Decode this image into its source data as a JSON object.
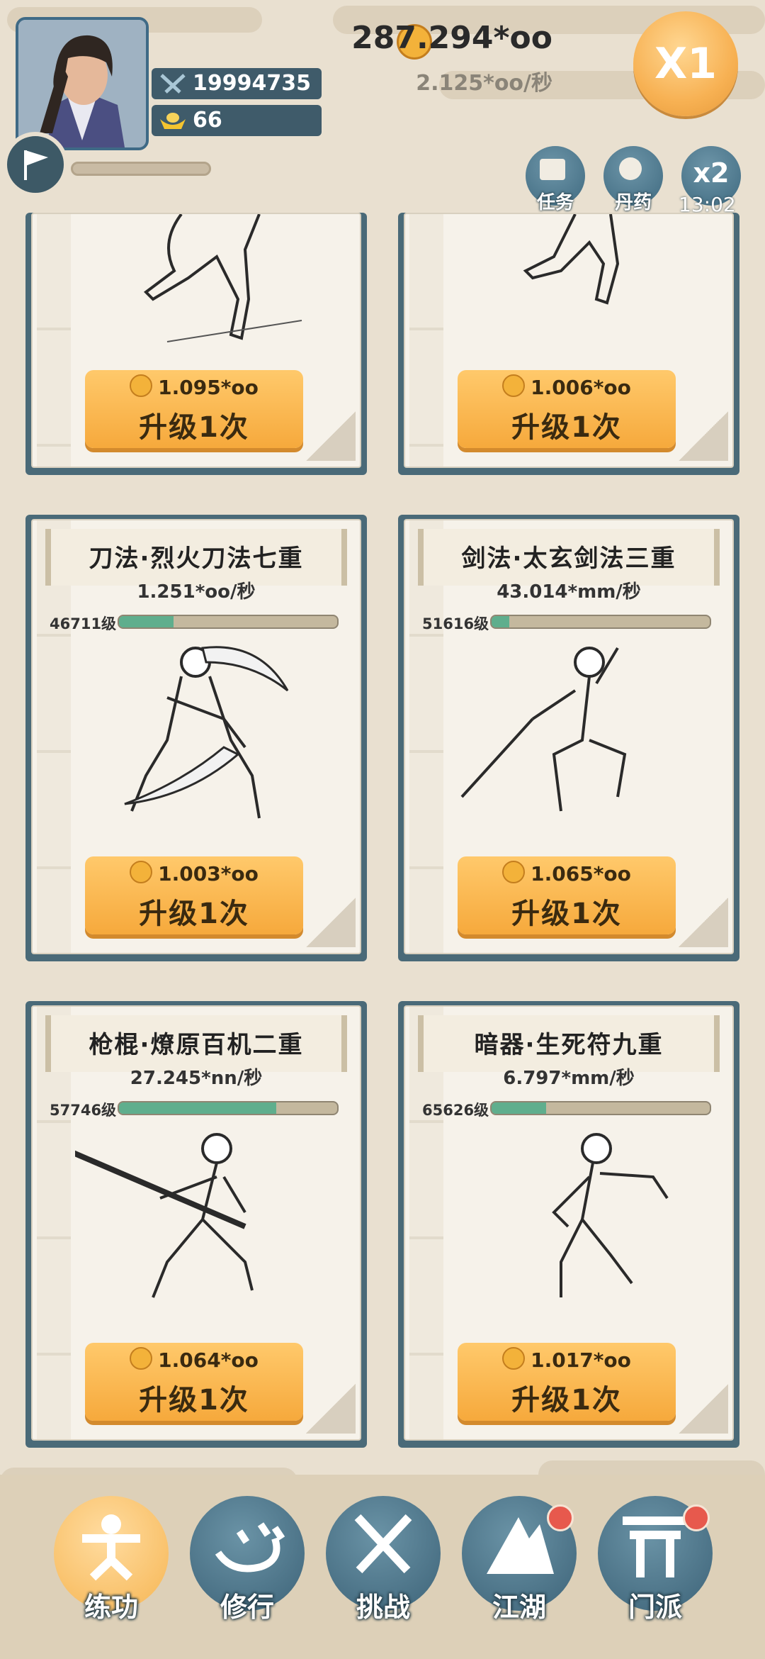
{
  "header": {
    "power": "19994735",
    "gold_ingot": "66",
    "coin_total": "287.294*oo",
    "coin_rate": "2.125*oo/秒",
    "speed_multiplier": "X1",
    "quick_buttons": [
      {
        "label": "任务",
        "icon": "scroll-icon"
      },
      {
        "label": "丹药",
        "icon": "elixir-icon"
      },
      {
        "label": "x2",
        "icon": "double-speed-icon"
      }
    ],
    "x2_timer": "13:02"
  },
  "partial_cards": [
    {
      "cost": "1.095*oo",
      "action": "升级1次"
    },
    {
      "cost": "1.006*oo",
      "action": "升级1次"
    }
  ],
  "cards": [
    {
      "title": "刀法·烈火刀法七重",
      "rate": "1.251*oo/秒",
      "level": "46711级",
      "progress": 0.25,
      "cost": "1.003*oo",
      "action": "升级1次",
      "figure": "saber-fighter"
    },
    {
      "title": "剑法·太玄剑法三重",
      "rate": "43.014*mm/秒",
      "level": "51616级",
      "progress": 0.08,
      "cost": "1.065*oo",
      "action": "升级1次",
      "figure": "sword-fighter"
    },
    {
      "title": "枪棍·燎原百机二重",
      "rate": "27.245*nn/秒",
      "level": "57746级",
      "progress": 0.72,
      "cost": "1.064*oo",
      "action": "升级1次",
      "figure": "spear-fighter"
    },
    {
      "title": "暗器·生死符九重",
      "rate": "6.797*mm/秒",
      "level": "65626级",
      "progress": 0.25,
      "cost": "1.017*oo",
      "action": "升级1次",
      "figure": "hidden-weapon-fighter"
    }
  ],
  "nav": [
    {
      "label": "练功",
      "icon": "martial-stance-icon",
      "active": true,
      "badge": false
    },
    {
      "label": "修行",
      "icon": "heart-icon",
      "active": false,
      "badge": false
    },
    {
      "label": "挑战",
      "icon": "crossed-swords-icon",
      "active": false,
      "badge": false
    },
    {
      "label": "江湖",
      "icon": "mountain-icon",
      "active": false,
      "badge": true
    },
    {
      "label": "门派",
      "icon": "gate-icon",
      "active": false,
      "badge": true
    }
  ],
  "colors": {
    "accent_orange": "#f6a93c",
    "teal": "#3f6a80",
    "progress_green": "#5fae8d",
    "badge_red": "#e7594d"
  }
}
